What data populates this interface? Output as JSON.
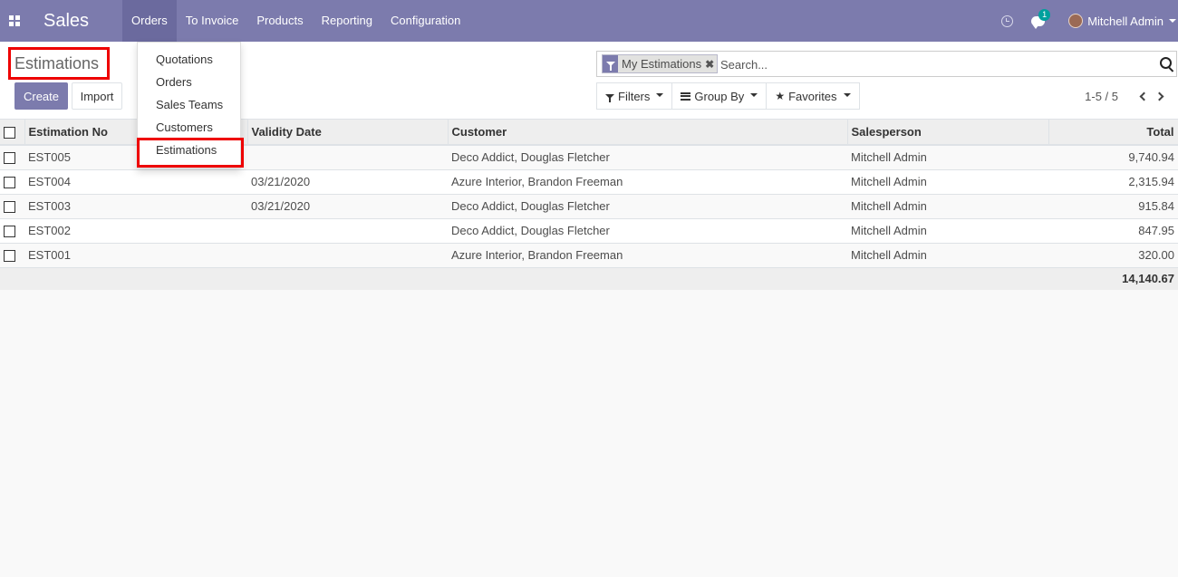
{
  "navbar": {
    "brand": "Sales",
    "menu": [
      "Orders",
      "To Invoice",
      "Products",
      "Reporting",
      "Configuration"
    ],
    "chat_count": "1",
    "user": "Mitchell Admin"
  },
  "orders_menu": [
    "Quotations",
    "Orders",
    "Sales Teams",
    "Customers",
    "Estimations"
  ],
  "control": {
    "title": "Estimations",
    "create": "Create",
    "import": "Import",
    "facet": "My Estimations",
    "search_placeholder": "Search...",
    "filters": "Filters",
    "group_by": "Group By",
    "favorites": "Favorites",
    "pager": "1-5 / 5"
  },
  "table": {
    "headers": [
      "Estimation No",
      "Validity Date",
      "Customer",
      "Salesperson",
      "Total"
    ],
    "rows": [
      [
        "EST005",
        "",
        "Deco Addict, Douglas Fletcher",
        "Mitchell Admin",
        "9,740.94"
      ],
      [
        "EST004",
        "03/21/2020",
        "Azure Interior, Brandon Freeman",
        "Mitchell Admin",
        "2,315.94"
      ],
      [
        "EST003",
        "03/21/2020",
        "Deco Addict, Douglas Fletcher",
        "Mitchell Admin",
        "915.84"
      ],
      [
        "EST002",
        "",
        "Deco Addict, Douglas Fletcher",
        "Mitchell Admin",
        "847.95"
      ],
      [
        "EST001",
        "",
        "Azure Interior, Brandon Freeman",
        "Mitchell Admin",
        "320.00"
      ]
    ],
    "total": "14,140.67"
  },
  "colors": {
    "navbar": "#7c7bad",
    "highlight": "#ee0000"
  }
}
